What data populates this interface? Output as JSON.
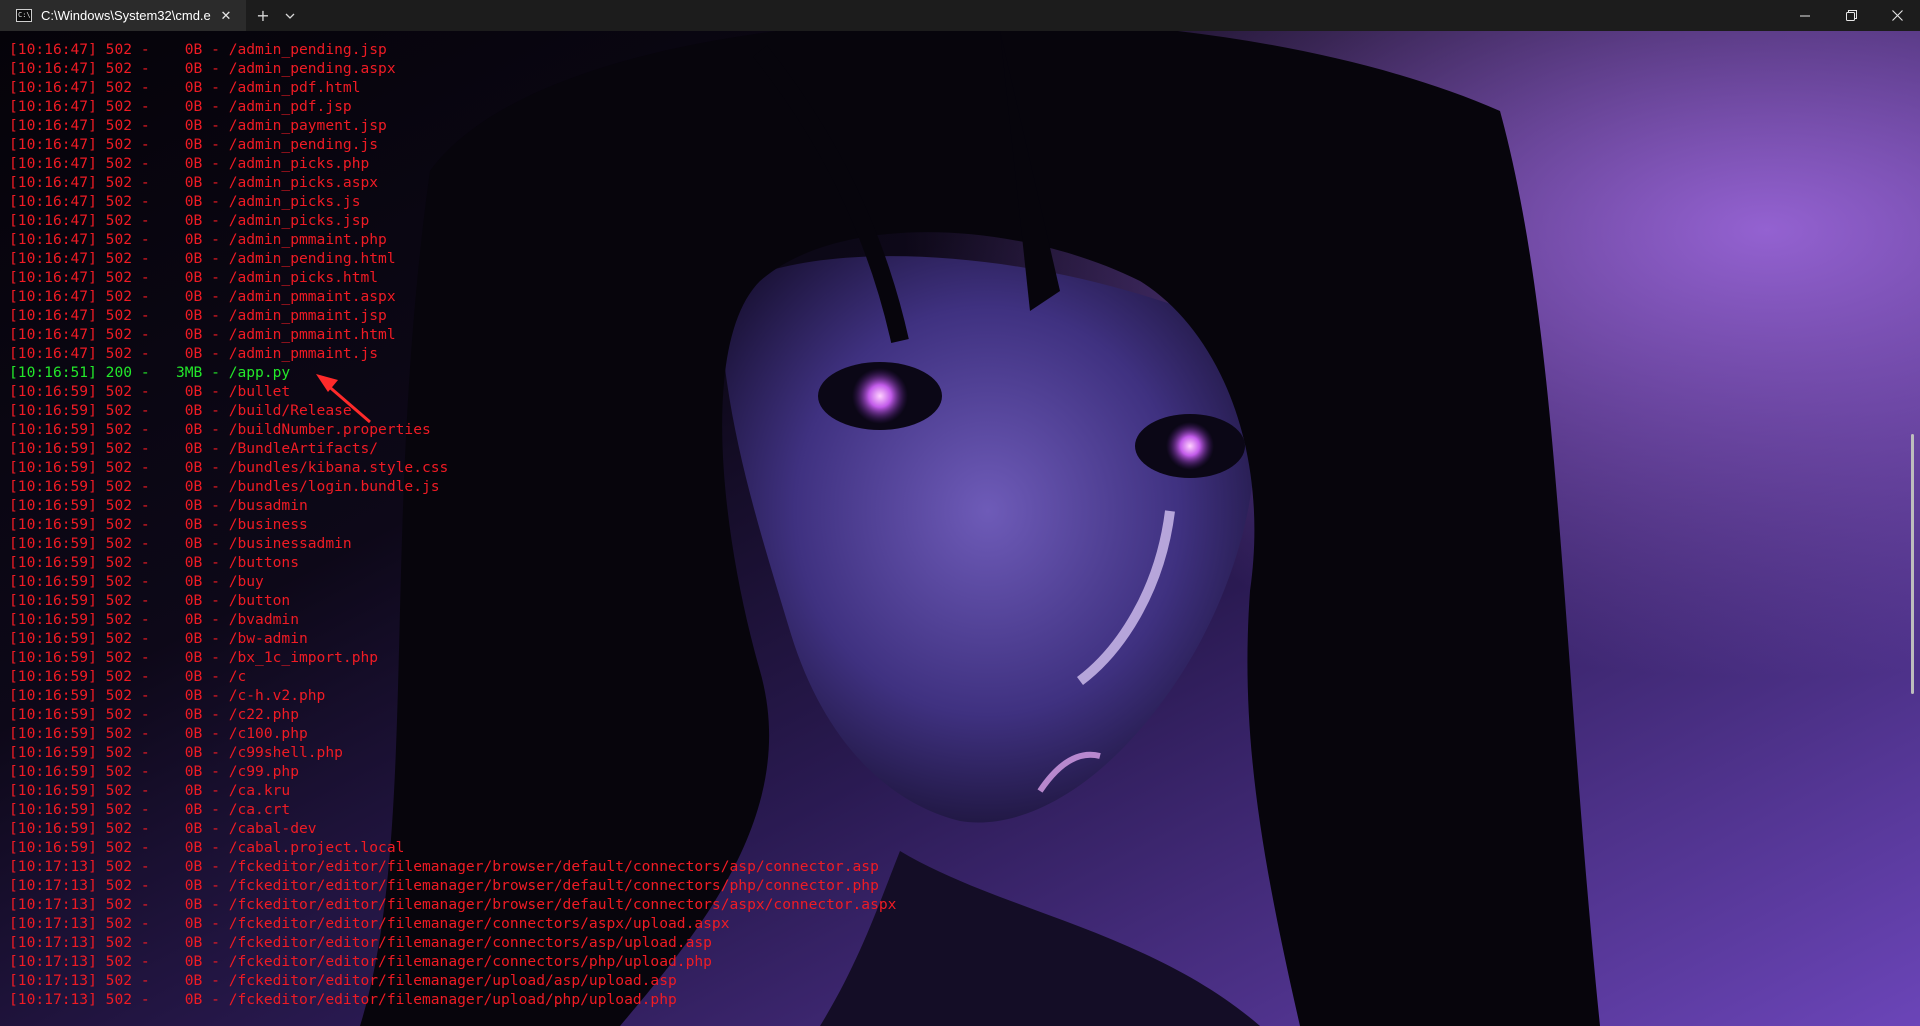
{
  "window": {
    "tab_title": "C:\\Windows\\System32\\cmd.e",
    "tab_icon_text": "C:\\",
    "tab_close": "✕",
    "new_tab": "+",
    "dropdown": "⌄",
    "minimize": "—",
    "maximize": "❐",
    "close": "✕"
  },
  "colors": {
    "status_error": "#f01b24",
    "status_ok": "#23e82a",
    "titlebar": "#1c1c1c",
    "tab": "#2b2b2b"
  },
  "terminal": {
    "lines": [
      {
        "time": "10:16:47",
        "status": "502",
        "size": "0B",
        "path": "/admin_pending.jsp"
      },
      {
        "time": "10:16:47",
        "status": "502",
        "size": "0B",
        "path": "/admin_pending.aspx"
      },
      {
        "time": "10:16:47",
        "status": "502",
        "size": "0B",
        "path": "/admin_pdf.html"
      },
      {
        "time": "10:16:47",
        "status": "502",
        "size": "0B",
        "path": "/admin_pdf.jsp"
      },
      {
        "time": "10:16:47",
        "status": "502",
        "size": "0B",
        "path": "/admin_payment.jsp"
      },
      {
        "time": "10:16:47",
        "status": "502",
        "size": "0B",
        "path": "/admin_pending.js"
      },
      {
        "time": "10:16:47",
        "status": "502",
        "size": "0B",
        "path": "/admin_picks.php"
      },
      {
        "time": "10:16:47",
        "status": "502",
        "size": "0B",
        "path": "/admin_picks.aspx"
      },
      {
        "time": "10:16:47",
        "status": "502",
        "size": "0B",
        "path": "/admin_picks.js"
      },
      {
        "time": "10:16:47",
        "status": "502",
        "size": "0B",
        "path": "/admin_picks.jsp"
      },
      {
        "time": "10:16:47",
        "status": "502",
        "size": "0B",
        "path": "/admin_pmmaint.php"
      },
      {
        "time": "10:16:47",
        "status": "502",
        "size": "0B",
        "path": "/admin_pending.html"
      },
      {
        "time": "10:16:47",
        "status": "502",
        "size": "0B",
        "path": "/admin_picks.html"
      },
      {
        "time": "10:16:47",
        "status": "502",
        "size": "0B",
        "path": "/admin_pmmaint.aspx"
      },
      {
        "time": "10:16:47",
        "status": "502",
        "size": "0B",
        "path": "/admin_pmmaint.jsp"
      },
      {
        "time": "10:16:47",
        "status": "502",
        "size": "0B",
        "path": "/admin_pmmaint.html"
      },
      {
        "time": "10:16:47",
        "status": "502",
        "size": "0B",
        "path": "/admin_pmmaint.js"
      },
      {
        "time": "10:16:51",
        "status": "200",
        "size": "3MB",
        "path": "/app.py"
      },
      {
        "time": "10:16:59",
        "status": "502",
        "size": "0B",
        "path": "/bullet"
      },
      {
        "time": "10:16:59",
        "status": "502",
        "size": "0B",
        "path": "/build/Release"
      },
      {
        "time": "10:16:59",
        "status": "502",
        "size": "0B",
        "path": "/buildNumber.properties"
      },
      {
        "time": "10:16:59",
        "status": "502",
        "size": "0B",
        "path": "/BundleArtifacts/"
      },
      {
        "time": "10:16:59",
        "status": "502",
        "size": "0B",
        "path": "/bundles/kibana.style.css"
      },
      {
        "time": "10:16:59",
        "status": "502",
        "size": "0B",
        "path": "/bundles/login.bundle.js"
      },
      {
        "time": "10:16:59",
        "status": "502",
        "size": "0B",
        "path": "/busadmin"
      },
      {
        "time": "10:16:59",
        "status": "502",
        "size": "0B",
        "path": "/business"
      },
      {
        "time": "10:16:59",
        "status": "502",
        "size": "0B",
        "path": "/businessadmin"
      },
      {
        "time": "10:16:59",
        "status": "502",
        "size": "0B",
        "path": "/buttons"
      },
      {
        "time": "10:16:59",
        "status": "502",
        "size": "0B",
        "path": "/buy"
      },
      {
        "time": "10:16:59",
        "status": "502",
        "size": "0B",
        "path": "/button"
      },
      {
        "time": "10:16:59",
        "status": "502",
        "size": "0B",
        "path": "/bvadmin"
      },
      {
        "time": "10:16:59",
        "status": "502",
        "size": "0B",
        "path": "/bw-admin"
      },
      {
        "time": "10:16:59",
        "status": "502",
        "size": "0B",
        "path": "/bx_1c_import.php"
      },
      {
        "time": "10:16:59",
        "status": "502",
        "size": "0B",
        "path": "/c"
      },
      {
        "time": "10:16:59",
        "status": "502",
        "size": "0B",
        "path": "/c-h.v2.php"
      },
      {
        "time": "10:16:59",
        "status": "502",
        "size": "0B",
        "path": "/c22.php"
      },
      {
        "time": "10:16:59",
        "status": "502",
        "size": "0B",
        "path": "/c100.php"
      },
      {
        "time": "10:16:59",
        "status": "502",
        "size": "0B",
        "path": "/c99shell.php"
      },
      {
        "time": "10:16:59",
        "status": "502",
        "size": "0B",
        "path": "/c99.php"
      },
      {
        "time": "10:16:59",
        "status": "502",
        "size": "0B",
        "path": "/ca.kru"
      },
      {
        "time": "10:16:59",
        "status": "502",
        "size": "0B",
        "path": "/ca.crt"
      },
      {
        "time": "10:16:59",
        "status": "502",
        "size": "0B",
        "path": "/cabal-dev"
      },
      {
        "time": "10:16:59",
        "status": "502",
        "size": "0B",
        "path": "/cabal.project.local"
      },
      {
        "time": "10:17:13",
        "status": "502",
        "size": "0B",
        "path": "/fckeditor/editor/filemanager/browser/default/connectors/asp/connector.asp"
      },
      {
        "time": "10:17:13",
        "status": "502",
        "size": "0B",
        "path": "/fckeditor/editor/filemanager/browser/default/connectors/php/connector.php"
      },
      {
        "time": "10:17:13",
        "status": "502",
        "size": "0B",
        "path": "/fckeditor/editor/filemanager/browser/default/connectors/aspx/connector.aspx"
      },
      {
        "time": "10:17:13",
        "status": "502",
        "size": "0B",
        "path": "/fckeditor/editor/filemanager/connectors/aspx/upload.aspx"
      },
      {
        "time": "10:17:13",
        "status": "502",
        "size": "0B",
        "path": "/fckeditor/editor/filemanager/connectors/asp/upload.asp"
      },
      {
        "time": "10:17:13",
        "status": "502",
        "size": "0B",
        "path": "/fckeditor/editor/filemanager/connectors/php/upload.php"
      },
      {
        "time": "10:17:13",
        "status": "502",
        "size": "0B",
        "path": "/fckeditor/editor/filemanager/upload/asp/upload.asp"
      },
      {
        "time": "10:17:13",
        "status": "502",
        "size": "0B",
        "path": "/fckeditor/editor/filemanager/upload/php/upload.php"
      }
    ]
  }
}
